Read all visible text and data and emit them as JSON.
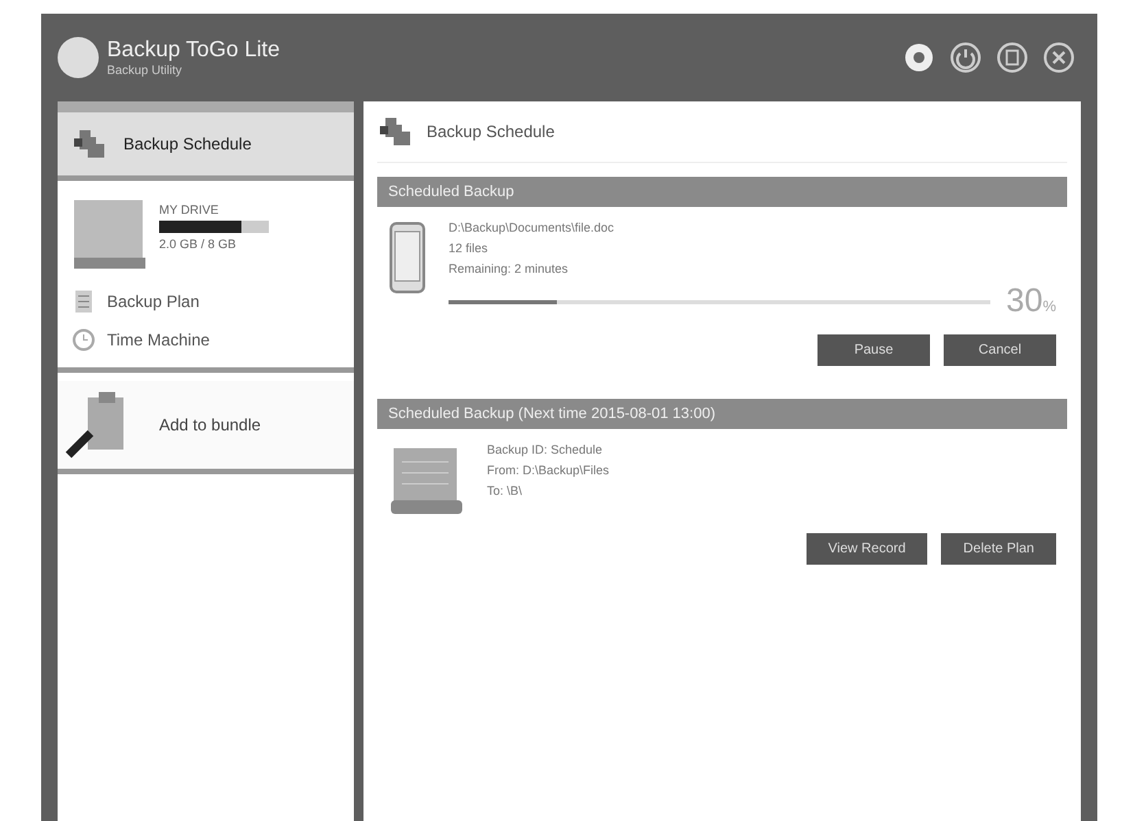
{
  "window": {
    "title": "Backup ToGo Lite",
    "subtitle": "Backup Utility"
  },
  "sidebar": {
    "items": [
      {
        "kind": "nav",
        "label": "Backup Schedule",
        "selected": true
      },
      {
        "kind": "device",
        "name": "MY DRIVE",
        "usage": "2.0 GB / 8 GB",
        "level": 0.75,
        "links": [
          {
            "label": "Backup Plan"
          },
          {
            "label": "Time Machine"
          }
        ]
      },
      {
        "kind": "nav",
        "label": "Add to bundle",
        "selected": false
      }
    ]
  },
  "main": {
    "title": "Backup Schedule",
    "sections": [
      {
        "kind": "progress",
        "header": "Scheduled Backup",
        "lines": [
          "D:\\Backup\\Documents\\file.doc",
          "12 files",
          "Remaining: 2 minutes"
        ],
        "level": 0.2,
        "percent": "30",
        "unit": "%",
        "buttons": [
          "Pause",
          "Cancel"
        ]
      },
      {
        "kind": "plan",
        "header": "Scheduled Backup (Next time 2015-08-01 13:00)",
        "lines": [
          "Backup ID: Schedule",
          "From: D:\\Backup\\Files",
          "To: \\B\\"
        ],
        "buttons": [
          "View Record",
          "Delete Plan"
        ]
      }
    ]
  }
}
